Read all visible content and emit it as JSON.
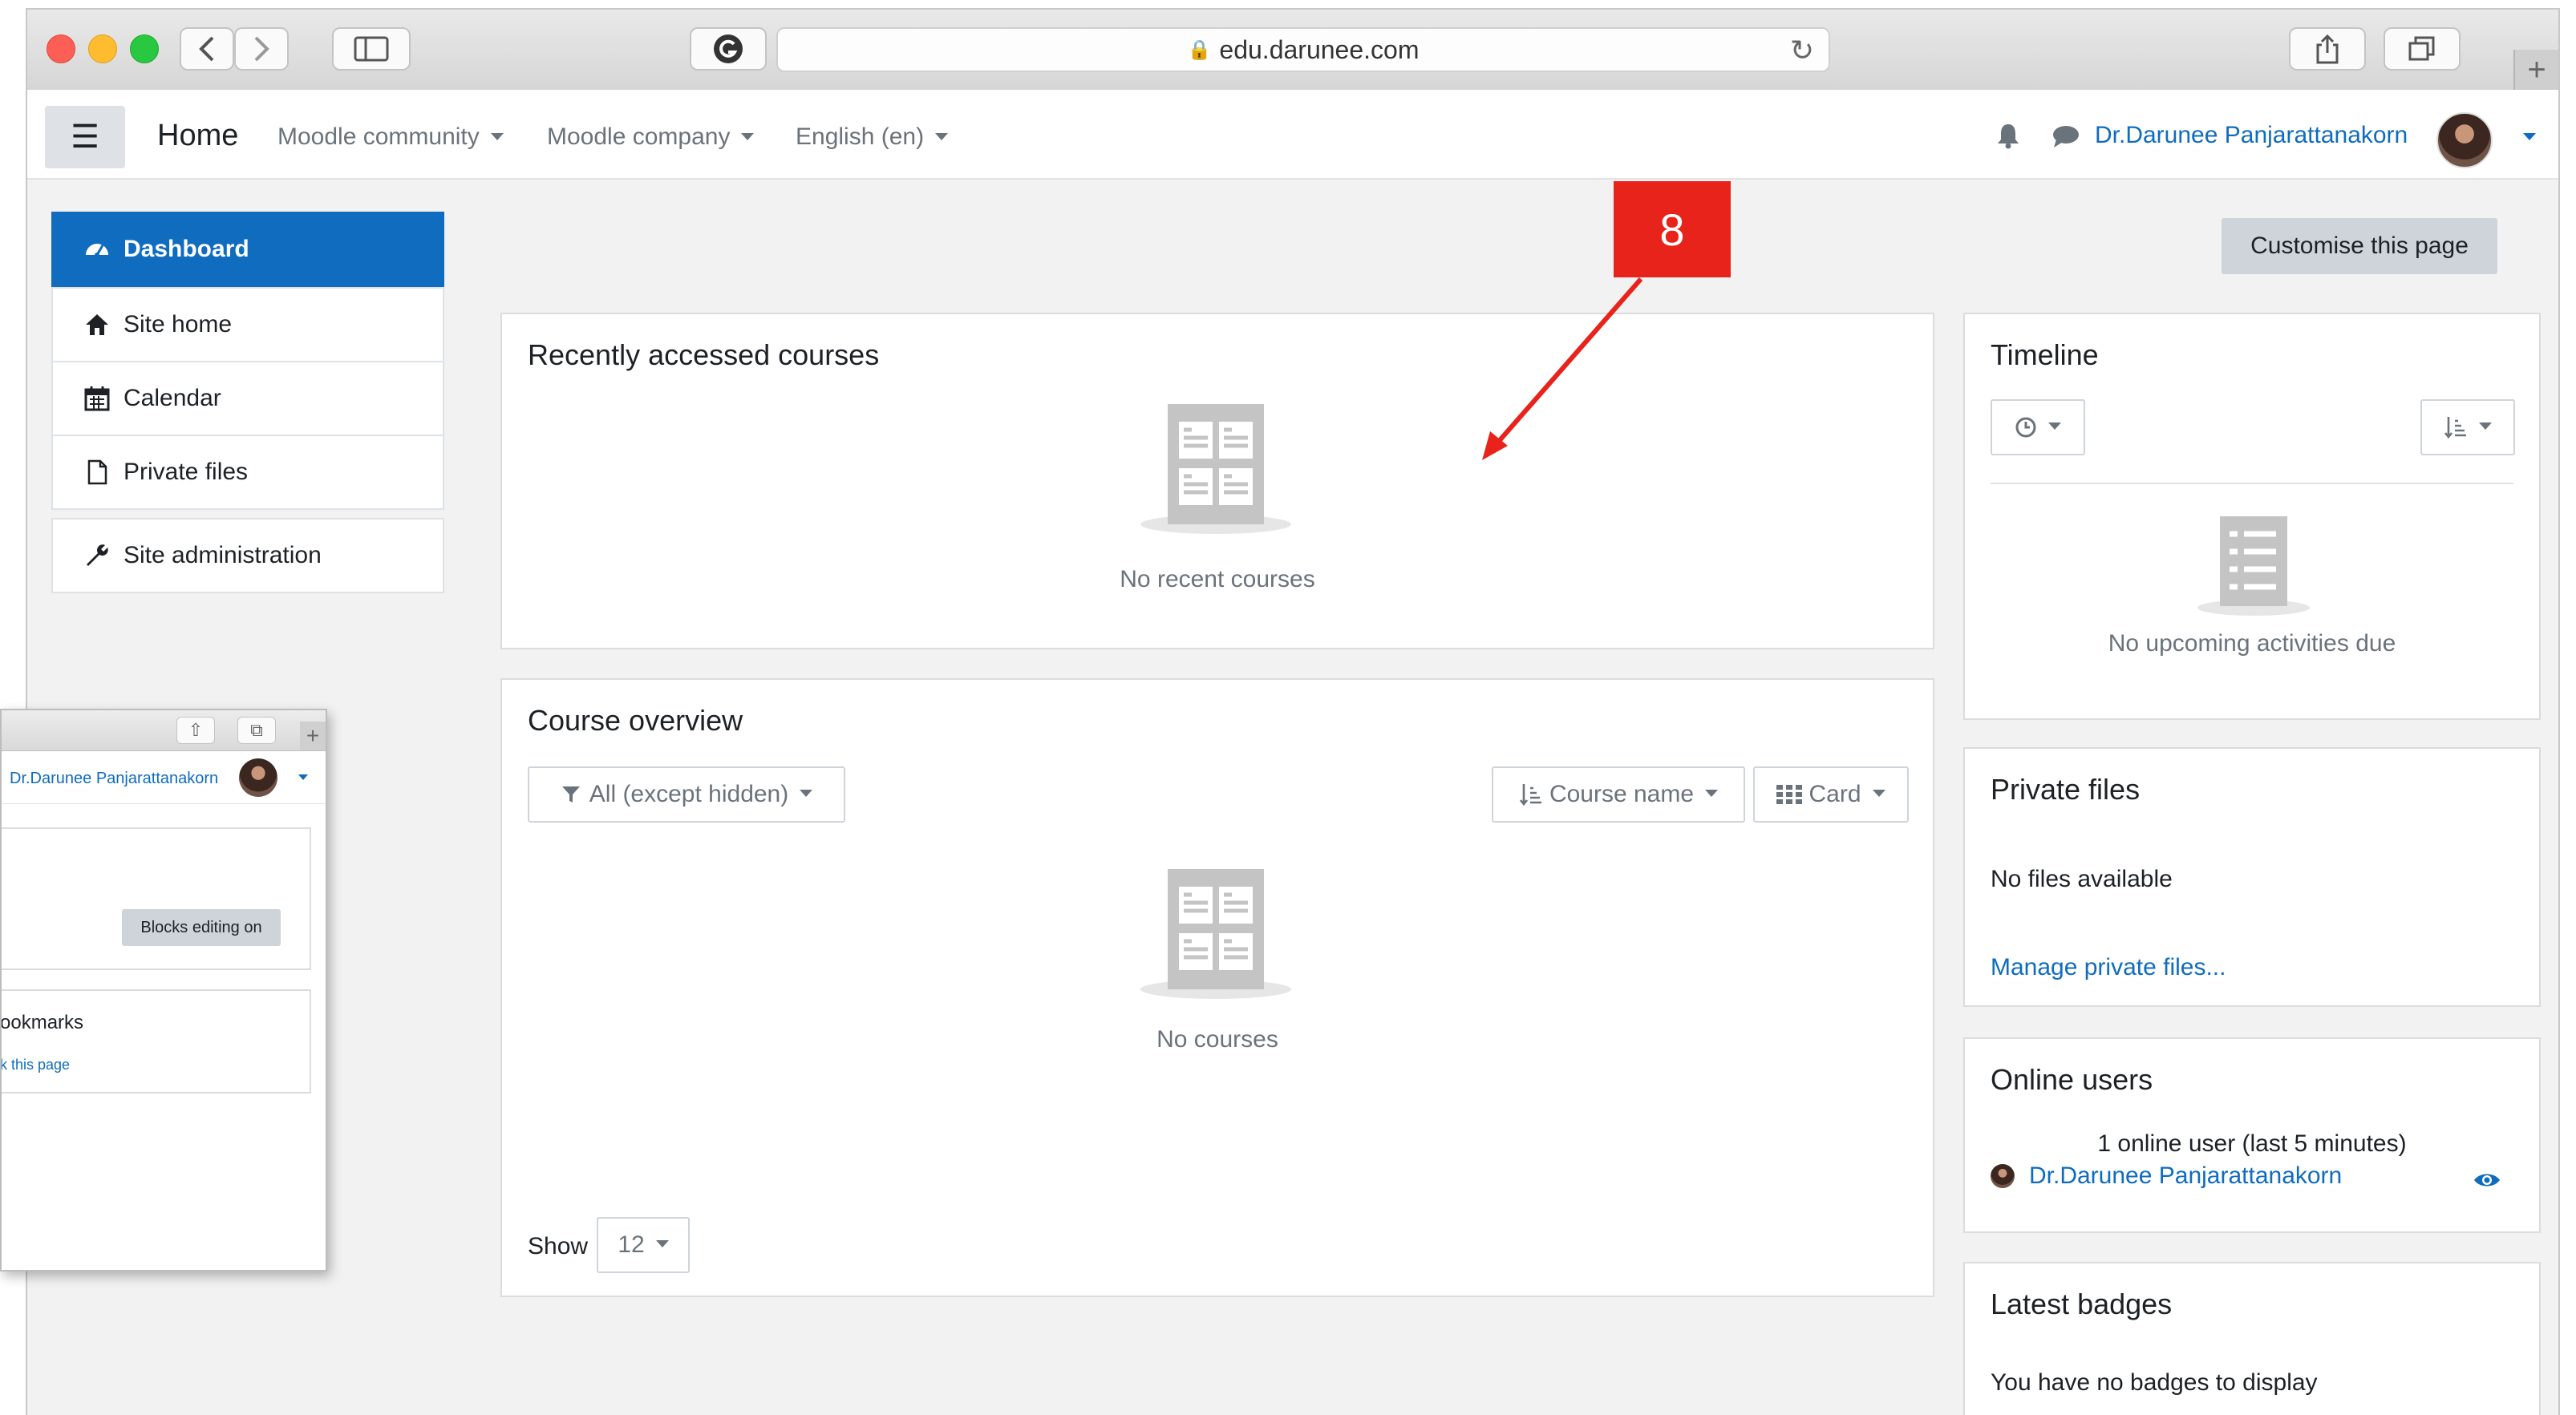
{
  "browser": {
    "url": "edu.darunee.com"
  },
  "navbar": {
    "brand": "Home",
    "menus": [
      "Moodle community",
      "Moodle company",
      "English (en)"
    ],
    "user_name": "Dr.Darunee Panjarattanakorn"
  },
  "drawer": {
    "items": [
      {
        "label": "Dashboard",
        "icon": "dashboard-icon",
        "active": true
      },
      {
        "label": "Site home",
        "icon": "home-icon"
      },
      {
        "label": "Calendar",
        "icon": "calendar-icon"
      },
      {
        "label": "Private files",
        "icon": "file-icon"
      },
      {
        "label": "Site administration",
        "icon": "wrench-icon"
      }
    ]
  },
  "page": {
    "customise_button": "Customise this page"
  },
  "recent_courses": {
    "title": "Recently accessed courses",
    "empty_text": "No recent courses"
  },
  "course_overview": {
    "title": "Course overview",
    "filter": "All (except hidden)",
    "sort": "Course name",
    "view": "Card",
    "empty_text": "No courses",
    "show_label": "Show",
    "show_value": "12"
  },
  "timeline": {
    "title": "Timeline",
    "empty_text": "No upcoming activities due"
  },
  "private_files": {
    "title": "Private files",
    "empty_text": "No files available",
    "manage_link": "Manage private files..."
  },
  "online_users": {
    "title": "Online users",
    "summary": "1 online user (last 5 minutes)",
    "user": "Dr.Darunee Panjarattanakorn"
  },
  "latest_badges": {
    "title": "Latest badges",
    "empty_text": "You have no badges to display"
  },
  "annotation": {
    "number": "8",
    "color": "#e8231b"
  },
  "overlay": {
    "user_name": "Dr.Darunee Panjarattanakorn",
    "blocks_button": "Blocks editing on",
    "bookmarks_title": "ookmarks",
    "bookmark_link": "k this page"
  },
  "colors": {
    "accent": "#0f6cbf",
    "muted_text": "#6a737b",
    "page_bg": "#f2f2f2"
  }
}
